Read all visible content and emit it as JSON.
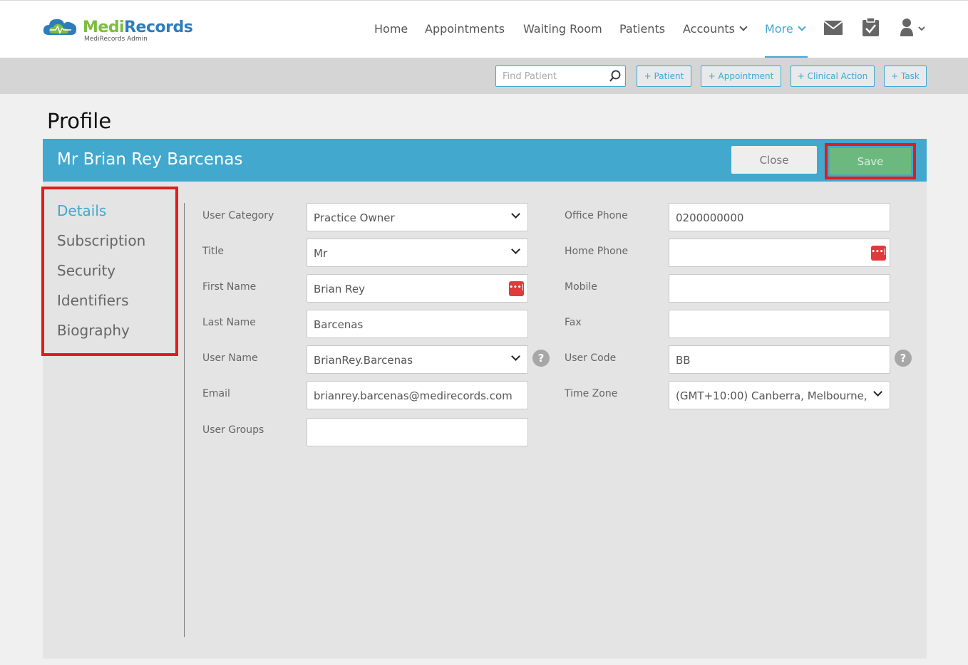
{
  "app": {
    "logo_medi": "Medi",
    "logo_records": "Records",
    "logo_sub": "MediRecords Admin"
  },
  "nav": {
    "home": "Home",
    "appointments": "Appointments",
    "waiting_room": "Waiting Room",
    "patients": "Patients",
    "accounts": "Accounts",
    "more": "More",
    "icons": [
      "mail-icon",
      "clipboard-check-icon",
      "user-icon"
    ]
  },
  "actionbar": {
    "find_placeholder": "Find Patient",
    "add_patient": "+ Patient",
    "add_appointment": "+ Appointment",
    "add_clinical_action": "+ Clinical Action",
    "add_task": "+ Task"
  },
  "page": {
    "title": "Profile",
    "profile_name": "Mr Brian Rey Barcenas",
    "close_label": "Close",
    "save_label": "Save"
  },
  "sidebar": {
    "items": [
      {
        "label": "Details",
        "active": true
      },
      {
        "label": "Subscription",
        "active": false
      },
      {
        "label": "Security",
        "active": false
      },
      {
        "label": "Identifiers",
        "active": false
      },
      {
        "label": "Biography",
        "active": false
      }
    ]
  },
  "form": {
    "left": [
      {
        "label": "User Category",
        "value": "Practice Owner",
        "type": "select"
      },
      {
        "label": "Title",
        "value": "Mr",
        "type": "select"
      },
      {
        "label": "First Name",
        "value": "Brian Rey",
        "type": "text"
      },
      {
        "label": "Last Name",
        "value": "Barcenas",
        "type": "text"
      },
      {
        "label": "User Name",
        "value": "BrianRey.Barcenas",
        "type": "select"
      },
      {
        "label": "Email",
        "value": "brianrey.barcenas@medirecords.com",
        "type": "text"
      },
      {
        "label": "User Groups",
        "value": "",
        "type": "text"
      }
    ],
    "right": [
      {
        "label": "Office Phone",
        "value": "0200000000",
        "type": "text"
      },
      {
        "label": "Home Phone",
        "value": "",
        "type": "text"
      },
      {
        "label": "Mobile",
        "value": "",
        "type": "text"
      },
      {
        "label": "Fax",
        "value": "",
        "type": "text"
      },
      {
        "label": "User Code",
        "value": "BB",
        "type": "text"
      },
      {
        "label": "Time Zone",
        "value": "(GMT+10:00) Canberra, Melbourne,",
        "type": "select"
      }
    ],
    "help_glyph": "?",
    "password_glyph": "•••|"
  },
  "colors": {
    "accent": "#42a8cd",
    "save": "#6cb97f",
    "highlight": "#e31b1b"
  }
}
